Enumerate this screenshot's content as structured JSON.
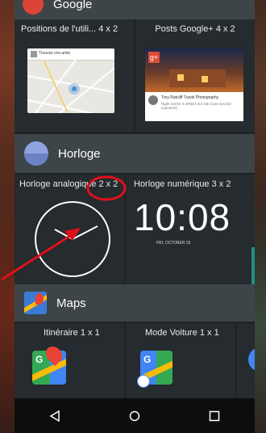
{
  "sections": {
    "top": {
      "header_label": "Google",
      "widgets": [
        {
          "label": "Positions de l'utili...  4 x 2"
        },
        {
          "label": "Posts Google+  4 x 2"
        }
      ],
      "post_author": "Trey Ratcliff",
      "post_source": "Trey Ratcliff  Travel Photography",
      "post_text": "Night Scene in ERDO dot 2ab (Live second exposure)",
      "map_card_title": "Trouvez vos amis"
    },
    "horloge": {
      "title": "Horloge",
      "widgets": [
        {
          "label": "Horloge analogique  2 x 2"
        },
        {
          "label": "Horloge numérique  3 x 2"
        }
      ],
      "digital_time": "10:08",
      "digital_date": "FRI, OCTOBER 03"
    },
    "maps": {
      "title": "Maps",
      "widgets": [
        {
          "label": "Itinéraire  1 x 1"
        },
        {
          "label": "Mode Voiture  1 x 1"
        }
      ]
    }
  },
  "navbar": {
    "back": "back-icon",
    "home": "home-icon",
    "recents": "recents-icon"
  },
  "colors": {
    "panel": "#1e2224",
    "cell": "#252b2e",
    "header": "#3d4549",
    "annotation_red": "#e0101a",
    "accent_teal": "#1f8f86"
  }
}
